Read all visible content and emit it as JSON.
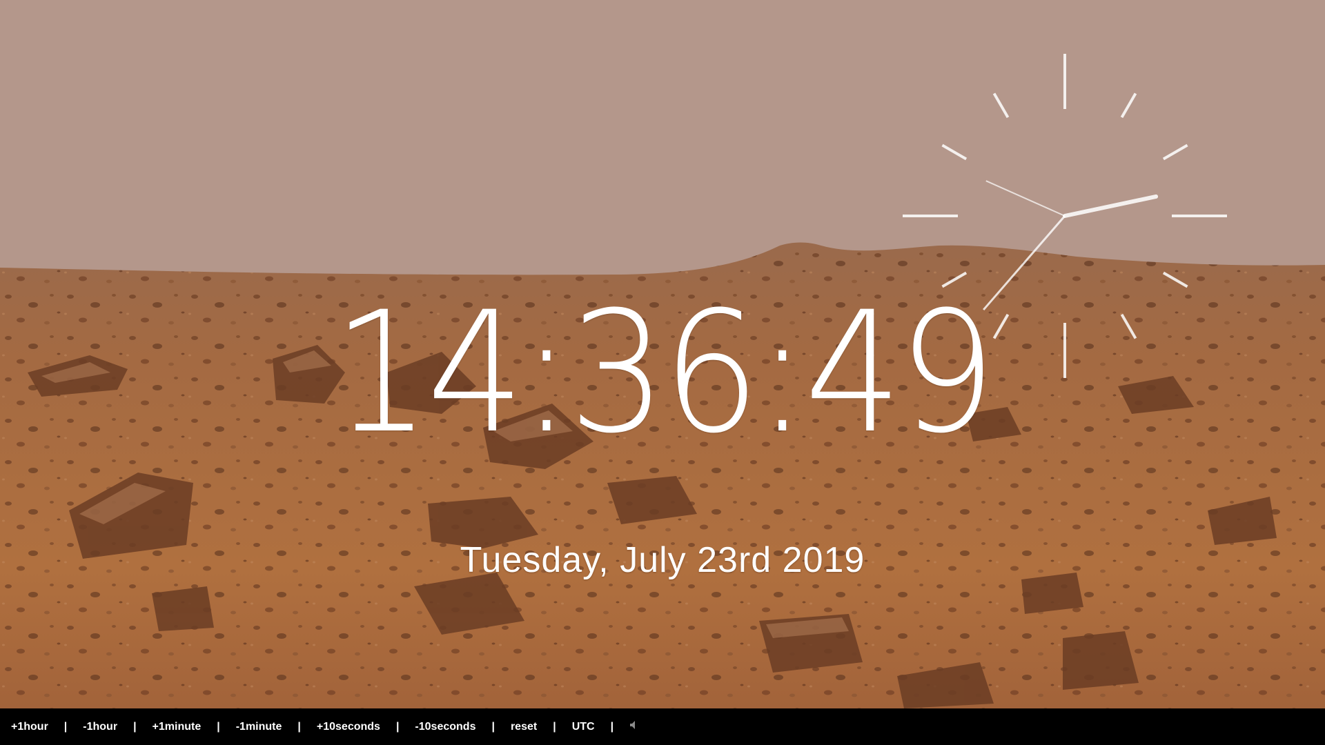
{
  "clock": {
    "time": "14:36:49",
    "date": "Tuesday, July 23rd 2019",
    "hour": 14,
    "minute": 36,
    "second": 49
  },
  "controls": {
    "items": [
      "+1hour",
      "-1hour",
      "+1minute",
      "-1minute",
      "+10seconds",
      "-10seconds",
      "reset",
      "UTC"
    ],
    "separator": "|",
    "sound_icon": "speaker-icon"
  },
  "colors": {
    "sky": "#b4978b",
    "ground": "#a9683e",
    "rock": "#7d4a2c",
    "text": "#ffffff",
    "bar": "#000000"
  }
}
